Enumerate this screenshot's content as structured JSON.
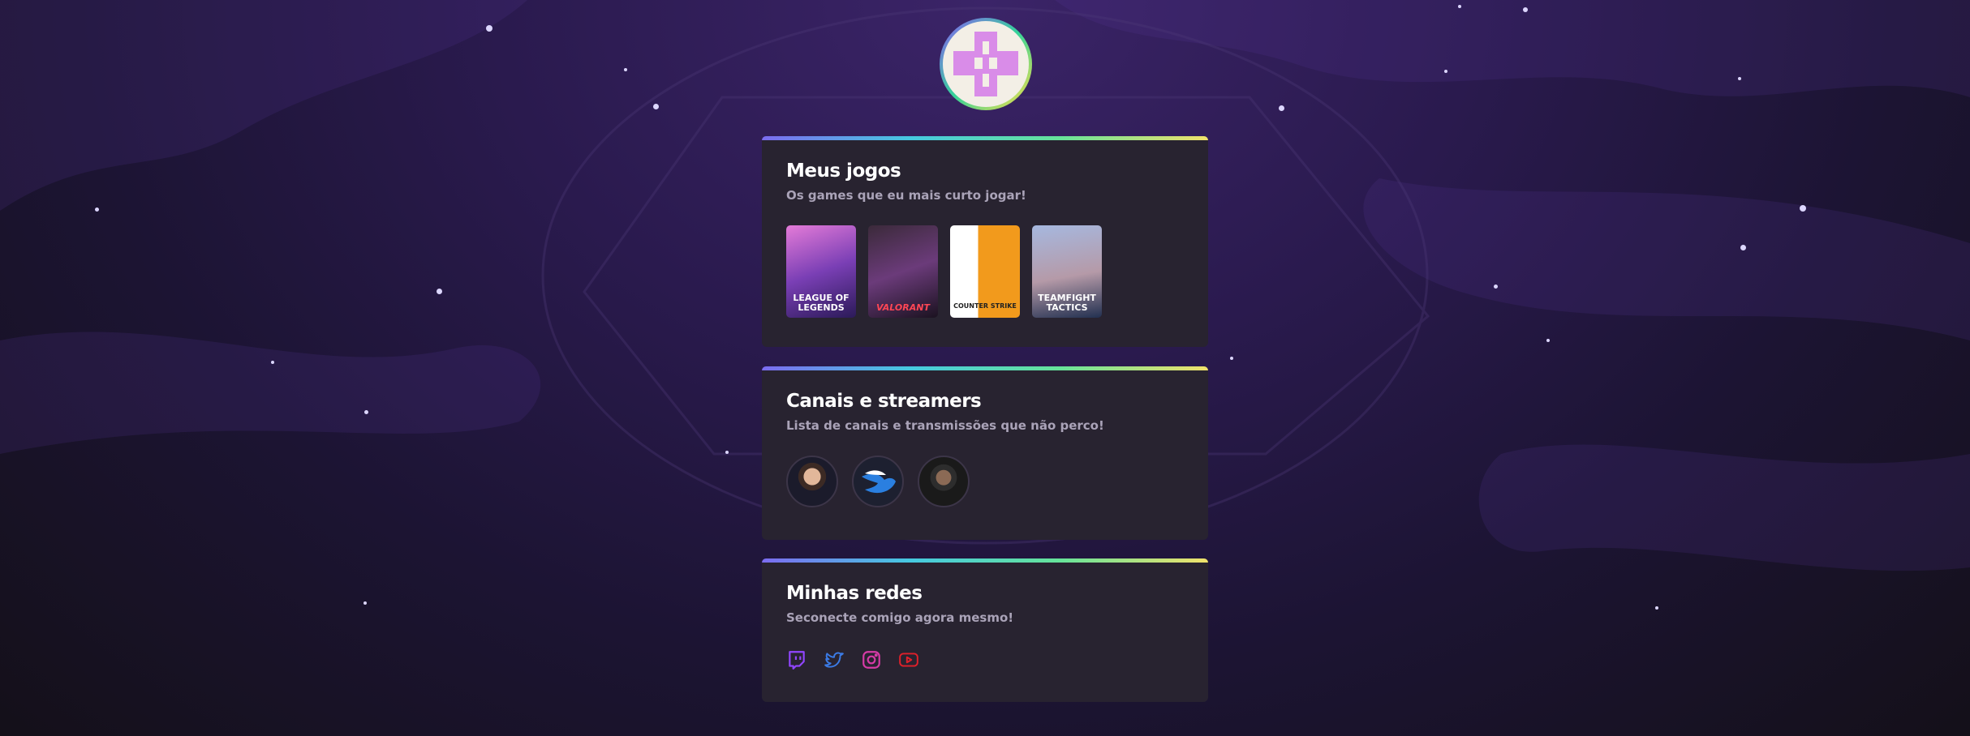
{
  "profile": {
    "avatar_icon": "plus-cross-icon"
  },
  "cards": {
    "games": {
      "title": "Meus jogos",
      "subtitle": "Os games que eu mais curto jogar!",
      "items": [
        {
          "label": "LEAGUE OF LEGENDS",
          "icon": "league-of-legends-cover"
        },
        {
          "label": "VALORANT",
          "icon": "valorant-cover"
        },
        {
          "label": "COUNTER STRIKE",
          "icon": "counter-strike-cover"
        },
        {
          "label": "TEAMFIGHT TACTICS",
          "icon": "teamfight-tactics-cover"
        }
      ]
    },
    "channels": {
      "title": "Canais e streamers",
      "subtitle": "Lista de canais e transmissões que não perco!",
      "items": [
        {
          "icon": "streamer-avatar-1"
        },
        {
          "icon": "winged-logo-avatar"
        },
        {
          "icon": "streamer-avatar-3"
        }
      ]
    },
    "socials": {
      "title": "Minhas redes",
      "subtitle": "Seconecte comigo agora mesmo!",
      "items": [
        {
          "icon": "twitch-icon",
          "color": "#9146ff"
        },
        {
          "icon": "twitter-icon",
          "color": "#3b7be6"
        },
        {
          "icon": "instagram-icon",
          "color": "#d63ba6"
        },
        {
          "icon": "youtube-icon",
          "color": "#e0202a"
        }
      ]
    }
  }
}
